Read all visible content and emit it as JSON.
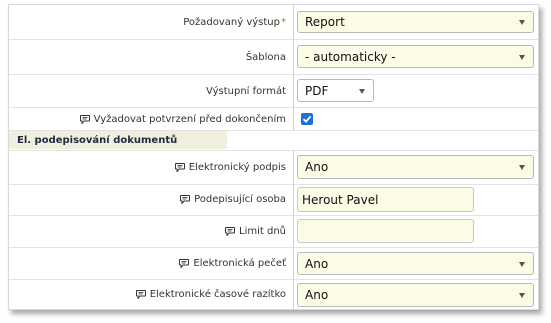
{
  "form": {
    "output": {
      "label": "Požadovaný výstup",
      "required_mark": "*",
      "value": "Report"
    },
    "template": {
      "label": "Šablona",
      "value": "- automaticky -"
    },
    "format": {
      "label": "Výstupní formát",
      "value": "PDF"
    },
    "confirm": {
      "label": "Vyžadovat potvrzení před dokončením",
      "checked": true
    },
    "section_title": "El. podepisování dokumentů",
    "e_signature": {
      "label": "Elektronický podpis",
      "value": "Ano"
    },
    "signer": {
      "label": "Podepisující osoba",
      "value": "Herout Pavel"
    },
    "day_limit": {
      "label": "Limit dnů",
      "value": ""
    },
    "e_seal": {
      "label": "Elektronická pečeť",
      "value": "Ano"
    },
    "e_timestamp": {
      "label": "Elektronické časové razítko",
      "value": "Ano"
    }
  },
  "colors": {
    "required": "#e06b00",
    "section_bg": "#f0eedc",
    "input_bg": "#fbfbe6",
    "checkbox": "#1e6fd9"
  },
  "icons": {
    "help": "comment-bubble-icon",
    "dropdown": "chevron-down-icon",
    "checkbox": "checkmark-icon"
  }
}
